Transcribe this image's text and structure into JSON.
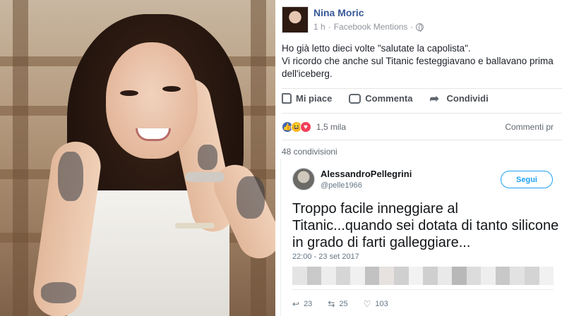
{
  "post": {
    "author": "Nina Moric",
    "time": "1 h",
    "separator": "·",
    "source": "Facebook Mentions",
    "text_line1": "Ho già letto dieci volte \"salutate la capolista\".",
    "text_line2": "Vi ricordo che anche sul Titanic festeggiavano e ballavano prima dell'iceberg."
  },
  "actions": {
    "like": "Mi piace",
    "comment": "Commenta",
    "share": "Condividi"
  },
  "reactions": {
    "count": "1,5 mila",
    "comments": "Commenti pr",
    "shares": "48 condivisioni"
  },
  "tweet": {
    "name": "AlessandroPellegrini",
    "handle": "@pelle1966",
    "follow": "Segui",
    "text": "Troppo facile inneggiare al Titanic...quando sei dotata di tanto silicone in grado di farti galleggiare...",
    "date": "22:00 - 23 set 2017",
    "replies": "23",
    "retweets": "25",
    "likes": "103"
  },
  "colors": {
    "facebook_link": "#385898",
    "twitter_blue": "#1da1f2",
    "like_reaction": "#4267b2",
    "haha_reaction": "#f7b928",
    "love_reaction": "#f33e58"
  },
  "icons": [
    "globe-icon",
    "like-icon",
    "comment-icon",
    "share-icon",
    "reply-icon",
    "retweet-icon",
    "heart-icon"
  ]
}
